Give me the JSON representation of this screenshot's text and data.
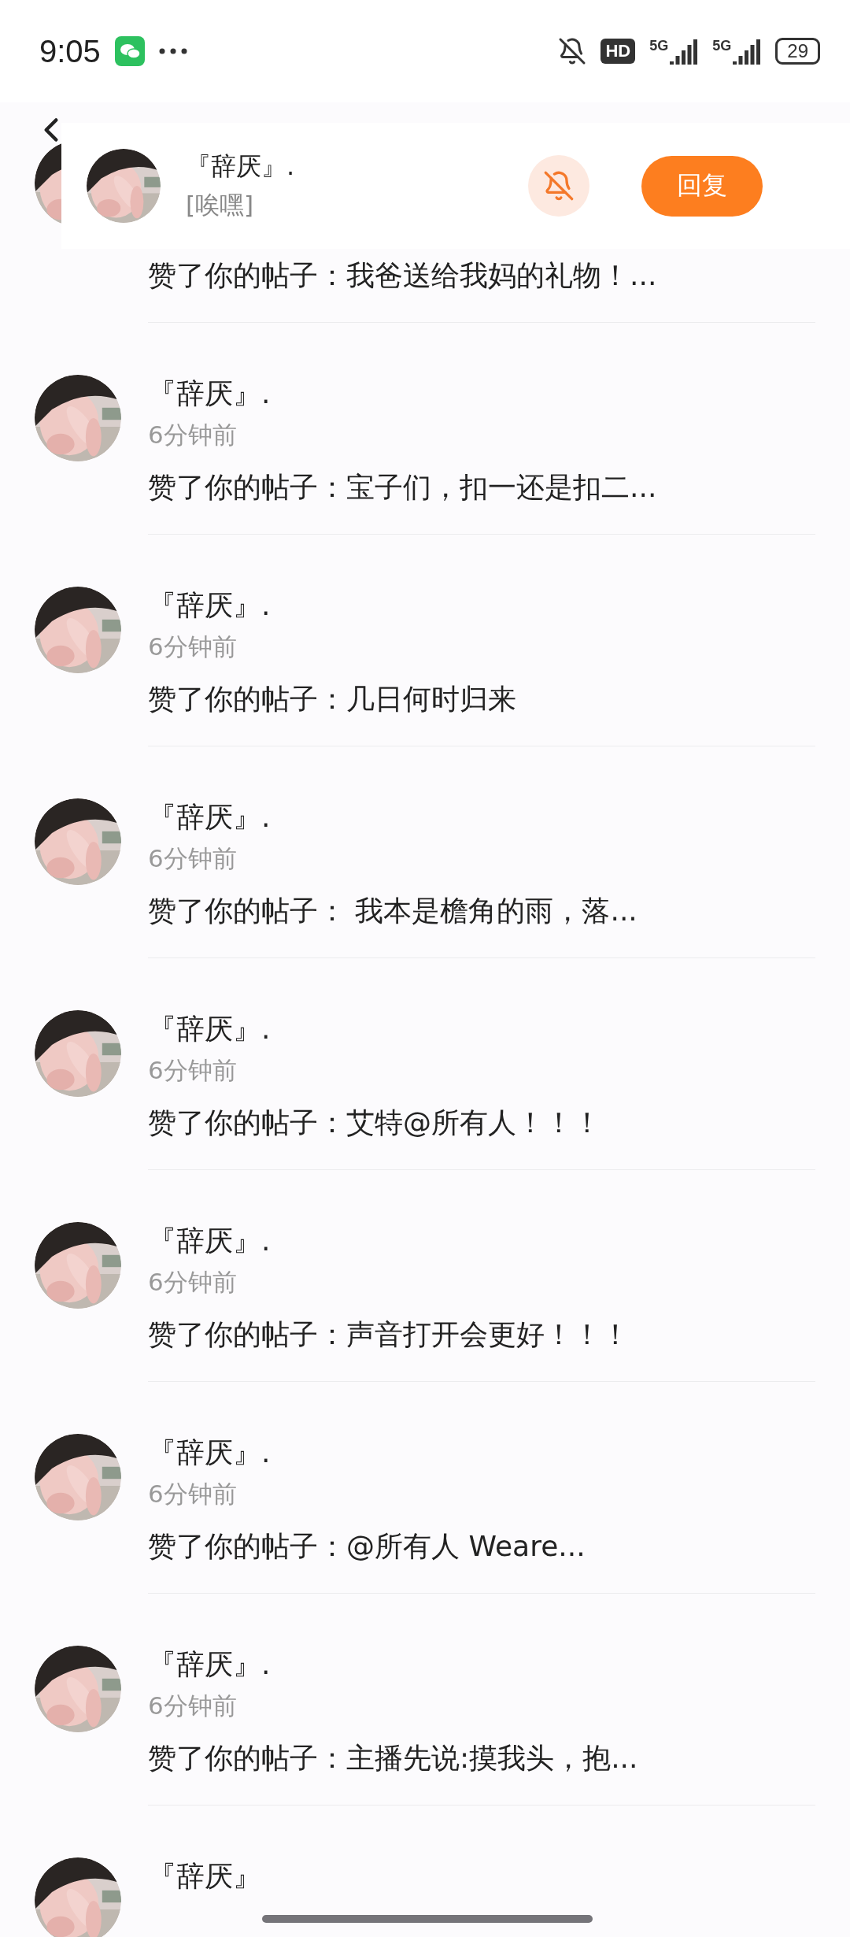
{
  "status_bar": {
    "time": "9:05",
    "hd": "HD",
    "networks": [
      "5G",
      "5G"
    ],
    "battery": "29"
  },
  "banner": {
    "name": "『辞厌』.",
    "message": "[唉嘿]",
    "reply_button": "回复"
  },
  "items": [
    {
      "kind": "partial",
      "text": "赞了你的帖子：我爸送给我妈的礼物！..."
    },
    {
      "kind": "full",
      "name": "『辞厌』.",
      "time": "6分钟前",
      "text": "赞了你的帖子：宝子们，扣一还是扣二..."
    },
    {
      "kind": "full",
      "name": "『辞厌』.",
      "time": "6分钟前",
      "text": "赞了你的帖子：几日何时归来"
    },
    {
      "kind": "full",
      "name": "『辞厌』.",
      "time": "6分钟前",
      "text": "赞了你的帖子： 我本是檐角的雨，落..."
    },
    {
      "kind": "full",
      "name": "『辞厌』.",
      "time": "6分钟前",
      "text": "赞了你的帖子：艾特@所有人！！！"
    },
    {
      "kind": "full",
      "name": "『辞厌』.",
      "time": "6分钟前",
      "text": "赞了你的帖子：声音打开会更好！！！"
    },
    {
      "kind": "full",
      "name": "『辞厌』.",
      "time": "6分钟前",
      "text": "赞了你的帖子：@所有人 Weare..."
    },
    {
      "kind": "full",
      "name": "『辞厌』.",
      "time": "6分钟前",
      "text": "赞了你的帖子：主播先说:摸我头，抱..."
    },
    {
      "kind": "name_only",
      "name": "『辞厌』"
    }
  ]
}
